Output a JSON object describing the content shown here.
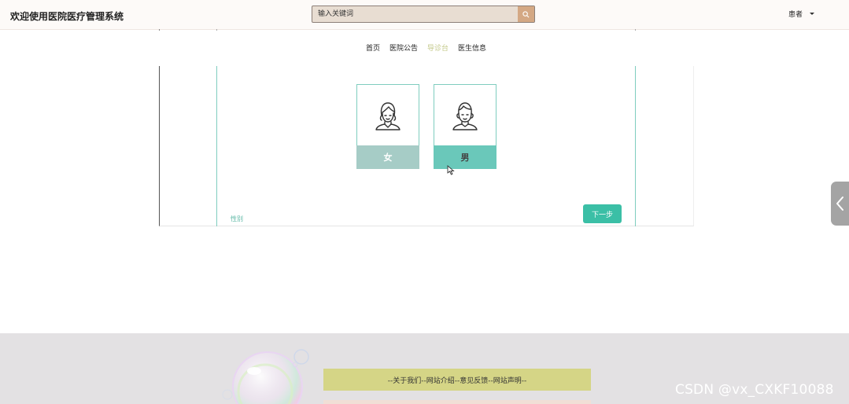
{
  "header": {
    "site_title": "欢迎使用医院医疗管理系统",
    "search_placeholder": "输入关键词",
    "search_icon": "search-icon",
    "user_label": "患者",
    "user_caret_icon": "caret-down-icon"
  },
  "nav": {
    "items": [
      {
        "label": "首页",
        "active": false
      },
      {
        "label": "医院公告",
        "active": false
      },
      {
        "label": "导诊台",
        "active": true
      },
      {
        "label": "医生信息",
        "active": false
      }
    ]
  },
  "gender_selector": {
    "field_label": "性别",
    "options": [
      {
        "label": "女",
        "icon": "female-avatar-icon"
      },
      {
        "label": "男",
        "icon": "male-avatar-icon"
      }
    ],
    "next_label": "下一步"
  },
  "side_toggle": {
    "icon": "chevron-left-icon"
  },
  "footer": {
    "links_text": "--关于我们--网站介绍--意见反馈--网站声明--"
  },
  "watermark": "CSDN @vx_CXKF10088",
  "colors": {
    "accent_teal": "#3bbfa6",
    "nav_active": "#c4c98a",
    "search_bg": "#e8ddd2",
    "footer_bar": "#d5d586"
  }
}
